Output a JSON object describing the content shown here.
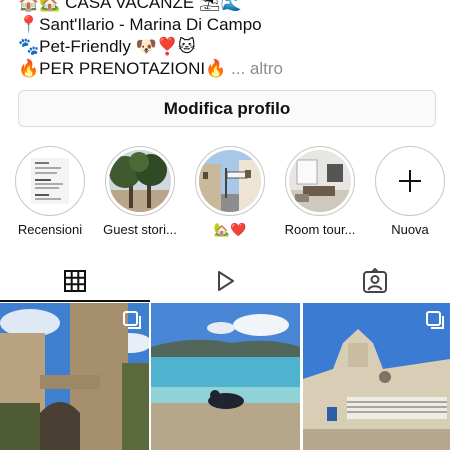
{
  "bio": {
    "line1_emoji_pre": "🏠🏡",
    "line1_text": "CASA VACANZE",
    "line1_emoji_post": "⛱🌊",
    "line2_emoji": "📍",
    "line2_text": "Sant'Ilario - Marina Di Campo",
    "line3_emoji": "🐾",
    "line3_text": "Pet-Friendly",
    "line3_emoji_post": "🐶❣️🐱",
    "line4_emoji": "🔥",
    "line4_text": "PER PRENOTAZIONI",
    "line4_emoji_post": "🔥",
    "more_label": "... altro"
  },
  "edit_profile_label": "Modifica profilo",
  "highlights": [
    {
      "label": "Recensioni",
      "icon": "review-screenshot"
    },
    {
      "label": "Guest stori...",
      "icon": "trees-photo"
    },
    {
      "label": "🏡❤️",
      "icon": "street-photo"
    },
    {
      "label": "Room tour...",
      "icon": "room-photo"
    },
    {
      "label": "Nuova",
      "icon": "plus-icon"
    }
  ],
  "tabs": [
    {
      "name": "grid",
      "icon": "grid-icon",
      "active": true
    },
    {
      "name": "reels",
      "icon": "play-icon",
      "active": false
    },
    {
      "name": "tagged",
      "icon": "tagged-user-icon",
      "active": false
    }
  ],
  "posts": [
    {
      "subject": "stone tower with archway",
      "multiple": true
    },
    {
      "subject": "beach with dog and blue sea",
      "multiple": false
    },
    {
      "subject": "church facade with music sign",
      "multiple": true
    }
  ],
  "colors": {
    "text": "#111111",
    "muted": "#8e8e8e",
    "border": "#dbdbdb",
    "button_bg": "#fafafa"
  }
}
